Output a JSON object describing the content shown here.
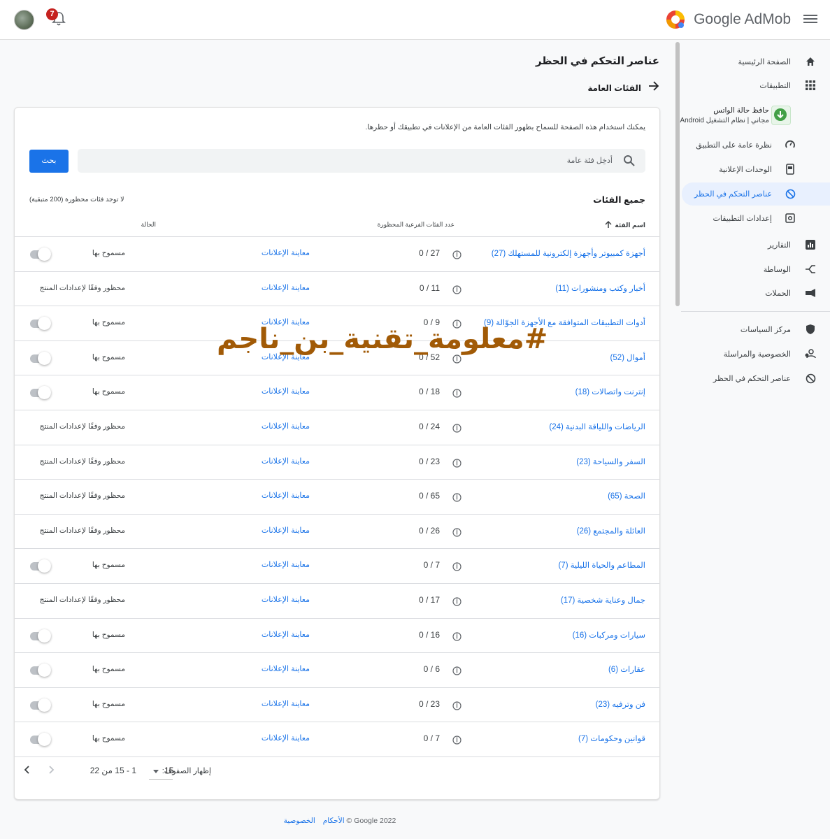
{
  "header": {
    "brand": "Google AdMob",
    "notification_count": "7"
  },
  "sidebar": {
    "home": "الصفحة الرئيسية",
    "apps": "التطبيقات",
    "app_name": "حافظ حالة الواتس",
    "app_sub": "مجاني | نظام التشغيل Android",
    "overview": "نظرة عامة على التطبيق",
    "ad_units": "الوحدات الإعلانية",
    "blocking_controls": "عناصر التحكم في الحظر",
    "app_settings": "إعدادات التطبيقات",
    "reports": "التقارير",
    "mediation": "الوساطة",
    "campaigns": "الحملات",
    "policy_center": "مركز السياسات",
    "privacy_messaging": "الخصوصية والمراسلة",
    "blocking_controls_main": "عناصر التحكم في الحظر"
  },
  "main": {
    "title": "عناصر التحكم في الحظر",
    "back_label": "الفئات العامة",
    "description": "يمكنك استخدام هذه الصفحة للسماح بظهور الفئات العامة من الإعلانات في تطبيقك أو حظرها.",
    "search_placeholder": "أدخِل فئة عامة",
    "search_button": "بحث",
    "list_title": "جميع الفئات",
    "blocked_note": "لا توجد فئات محظورة (200 متبقية)",
    "col_name": "اسم الفئة",
    "col_count": "عدد الفئات الفرعية المحظورة",
    "col_status": "الحالة"
  },
  "rows": [
    {
      "name": "أجهزة كمبيوتر وأجهزة إلكترونية للمستهلك (27)",
      "count": "0 / 27",
      "link": "معاينة الإعلانات",
      "status": "مسموح بها",
      "toggle": true
    },
    {
      "name": "أخبار وكتب ومنشورات (11)",
      "count": "0 / 11",
      "link": "معاينة الإعلانات",
      "status": "محظور وفقًا لإعدادات المنتج",
      "toggle": false
    },
    {
      "name": "أدوات التطبيقات المتوافقة مع الأجهزة الجوّالة (9)",
      "count": "0 / 9",
      "link": "معاينة الإعلانات",
      "status": "مسموح بها",
      "toggle": true
    },
    {
      "name": "أموال (52)",
      "count": "0 / 52",
      "link": "معاينة الإعلانات",
      "status": "مسموح بها",
      "toggle": true
    },
    {
      "name": "إنترنت واتصالات (18)",
      "count": "0 / 18",
      "link": "معاينة الإعلانات",
      "status": "مسموح بها",
      "toggle": true
    },
    {
      "name": "الرياضات واللياقة البدنية (24)",
      "count": "0 / 24",
      "link": "معاينة الإعلانات",
      "status": "محظور وفقًا لإعدادات المنتج",
      "toggle": false
    },
    {
      "name": "السفر والسياحة (23)",
      "count": "0 / 23",
      "link": "معاينة الإعلانات",
      "status": "محظور وفقًا لإعدادات المنتج",
      "toggle": false
    },
    {
      "name": "الصحة (65)",
      "count": "0 / 65",
      "link": "معاينة الإعلانات",
      "status": "محظور وفقًا لإعدادات المنتج",
      "toggle": false
    },
    {
      "name": "العائلة والمجتمع (26)",
      "count": "0 / 26",
      "link": "معاينة الإعلانات",
      "status": "محظور وفقًا لإعدادات المنتج",
      "toggle": false
    },
    {
      "name": "المطاعم والحياة الليلية (7)",
      "count": "0 / 7",
      "link": "معاينة الإعلانات",
      "status": "مسموح بها",
      "toggle": true
    },
    {
      "name": "جمال وعناية شخصية (17)",
      "count": "0 / 17",
      "link": "معاينة الإعلانات",
      "status": "محظور وفقًا لإعدادات المنتج",
      "toggle": false
    },
    {
      "name": "سيارات ومركبات (16)",
      "count": "0 / 16",
      "link": "معاينة الإعلانات",
      "status": "مسموح بها",
      "toggle": true
    },
    {
      "name": "عقارات (6)",
      "count": "0 / 6",
      "link": "معاينة الإعلانات",
      "status": "مسموح بها",
      "toggle": true
    },
    {
      "name": "فن وترفيه (23)",
      "count": "0 / 23",
      "link": "معاينة الإعلانات",
      "status": "مسموح بها",
      "toggle": true
    },
    {
      "name": "قوانين وحكومات (7)",
      "count": "0 / 7",
      "link": "معاينة الإعلانات",
      "status": "مسموح بها",
      "toggle": true
    }
  ],
  "pager": {
    "rows_label": "إظهار الصفوف:",
    "rows_value": "15",
    "range": "1 - 15 من 22"
  },
  "footer": {
    "copyright": "© Google 2022",
    "privacy": "الخصوصية",
    "terms": "الأحكام"
  },
  "watermark": "#معلومة_تقنية_بن_ناجم",
  "colors": {
    "accent": "#1a73e8",
    "watermark": "#a15a06",
    "badge": "#c5221f"
  }
}
